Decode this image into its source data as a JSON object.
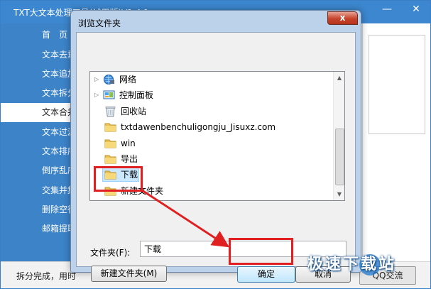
{
  "app": {
    "title": "TXT大文本处理工具(试用版)V1.4.1",
    "nav": [
      {
        "label": "首　页",
        "active": false
      },
      {
        "label": "文本去重",
        "active": false
      },
      {
        "label": "文本追加",
        "active": false
      },
      {
        "label": "文本拆分",
        "active": false
      },
      {
        "label": "文本合并",
        "active": true
      },
      {
        "label": "文本过滤",
        "active": false
      },
      {
        "label": "文本排序",
        "active": false
      },
      {
        "label": "倒序乱序",
        "active": false
      },
      {
        "label": "交集并集",
        "active": false
      },
      {
        "label": "删除空行",
        "active": false
      },
      {
        "label": "邮箱提取",
        "active": false
      }
    ],
    "status": "拆分完成，用时",
    "status_button": "QQ交流"
  },
  "dialog": {
    "title": "浏览文件夹",
    "close_label": "x",
    "tree": [
      {
        "label": "网络",
        "icon": "network-icon",
        "arrow": "▷"
      },
      {
        "label": "控制面板",
        "icon": "control-panel-icon",
        "arrow": "▷"
      },
      {
        "label": "回收站",
        "icon": "recycle-bin-icon",
        "arrow": ""
      },
      {
        "label": "txtdawenbenchuligongju_Jisuxz.com",
        "icon": "folder-icon",
        "arrow": ""
      },
      {
        "label": "win",
        "icon": "folder-icon",
        "arrow": ""
      },
      {
        "label": "导出",
        "icon": "folder-icon",
        "arrow": ""
      },
      {
        "label": "下载",
        "icon": "folder-icon",
        "arrow": "",
        "selected": true
      },
      {
        "label": "新建文件夹",
        "icon": "folder-icon",
        "arrow": ""
      }
    ],
    "folder_label": "文件夹(F):",
    "folder_value": "下载",
    "new_folder_button": "新建文件夹(M)",
    "ok_button": "确定",
    "cancel_button": "取消"
  },
  "watermark": "极速下载站",
  "colors": {
    "app_blue": "#3c83c8",
    "highlight_red": "#e02020",
    "selection_blue": "#cce8ff"
  }
}
